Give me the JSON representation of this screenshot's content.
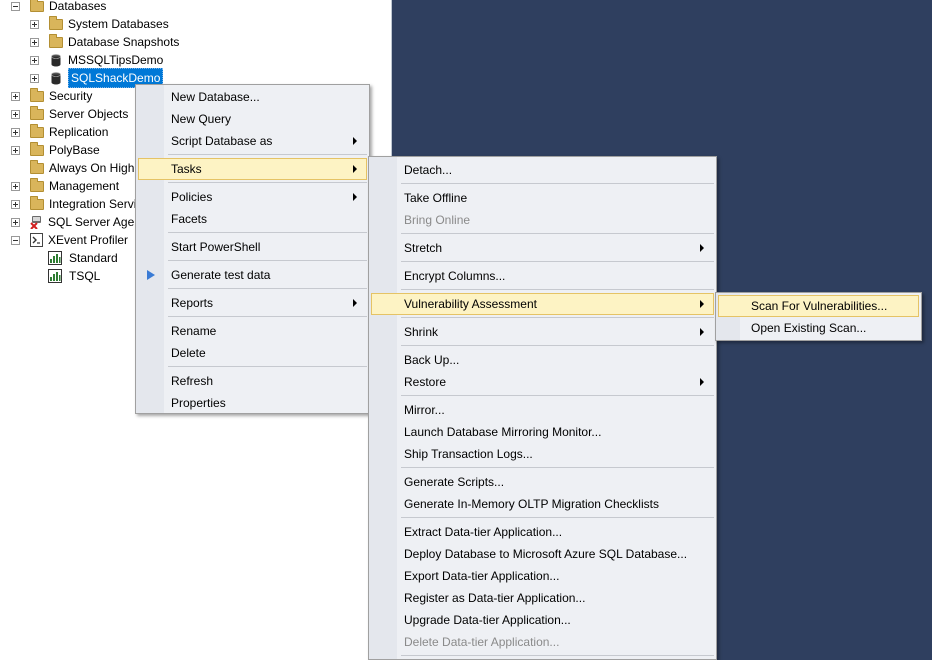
{
  "tree": {
    "databases": "Databases",
    "system_databases": "System Databases",
    "database_snapshots": "Database Snapshots",
    "db1": "MSSQLTipsDemo",
    "db2": "SQLShackDemo",
    "security": "Security",
    "server_objects": "Server Objects",
    "replication": "Replication",
    "polybase": "PolyBase",
    "always_on": "Always On High",
    "management": "Management",
    "integration": "Integration Servi",
    "agent": "SQL Server Agen",
    "xevent": "XEvent Profiler",
    "standard": "Standard",
    "tsql": "TSQL"
  },
  "context_menu": {
    "new_database": "New Database...",
    "new_query": "New Query",
    "script_database_as": "Script Database as",
    "tasks": "Tasks",
    "policies": "Policies",
    "facets": "Facets",
    "start_powershell": "Start PowerShell",
    "generate_test_data": "Generate test data",
    "reports": "Reports",
    "rename": "Rename",
    "delete": "Delete",
    "refresh": "Refresh",
    "properties": "Properties"
  },
  "tasks_menu": {
    "detach": "Detach...",
    "take_offline": "Take Offline",
    "bring_online": "Bring Online",
    "stretch": "Stretch",
    "encrypt_columns": "Encrypt Columns...",
    "vulnerability_assessment": "Vulnerability Assessment",
    "shrink": "Shrink",
    "back_up": "Back Up...",
    "restore": "Restore",
    "mirror": "Mirror...",
    "launch_mirroring_monitor": "Launch Database Mirroring Monitor...",
    "ship_transaction_logs": "Ship Transaction Logs...",
    "generate_scripts": "Generate Scripts...",
    "generate_inmemory": "Generate In-Memory OLTP Migration Checklists",
    "extract_dac": "Extract Data-tier Application...",
    "deploy_azure": "Deploy Database to Microsoft Azure SQL Database...",
    "export_dac": "Export Data-tier Application...",
    "register_dac": "Register as Data-tier Application...",
    "upgrade_dac": "Upgrade Data-tier Application...",
    "delete_dac": "Delete Data-tier Application..."
  },
  "va_menu": {
    "scan": "Scan For Vulnerabilities...",
    "open_existing": "Open Existing Scan..."
  },
  "colors": {
    "selection": "#0078d7",
    "menu_highlight": "#fdf3c4",
    "background_dark": "#2f3f5f"
  }
}
